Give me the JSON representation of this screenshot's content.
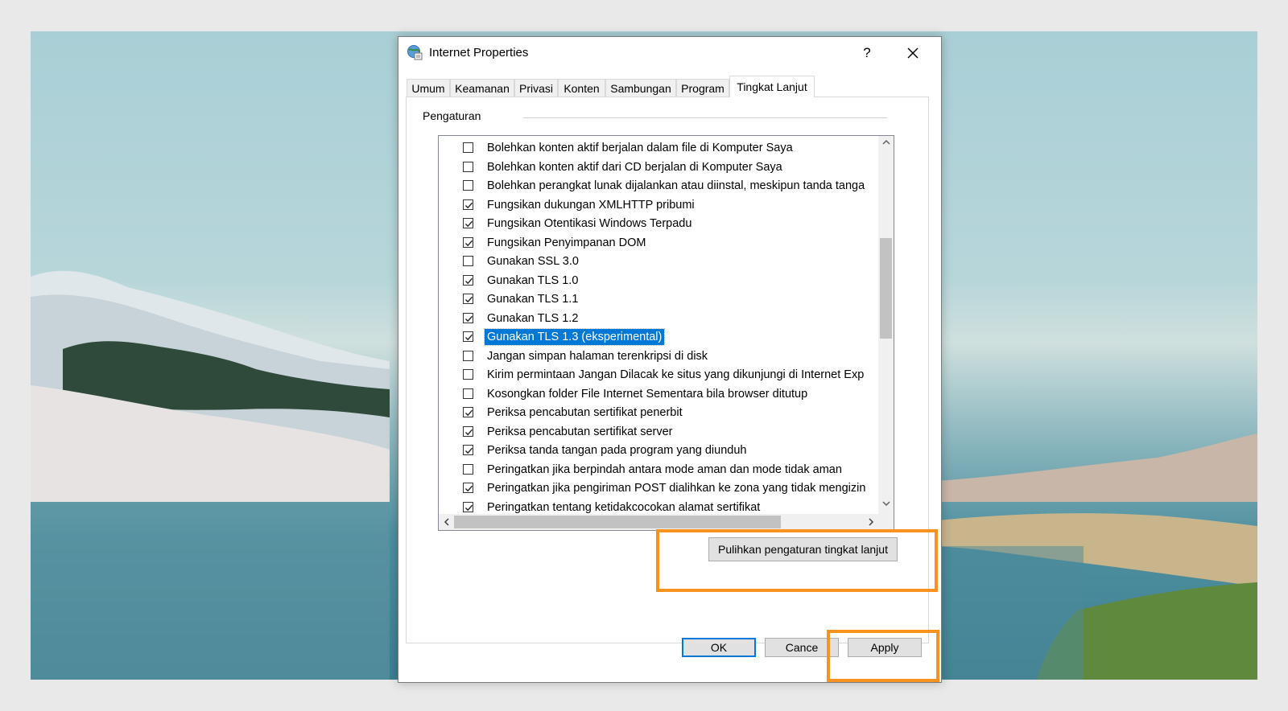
{
  "window": {
    "title": "Internet Properties",
    "help_label": "?",
    "close_label": "✕"
  },
  "tabs": [
    {
      "label": "Umum",
      "active": false
    },
    {
      "label": "Keamanan",
      "active": false
    },
    {
      "label": "Privasi",
      "active": false
    },
    {
      "label": "Konten",
      "active": false
    },
    {
      "label": "Sambungan",
      "active": false
    },
    {
      "label": "Program",
      "active": false
    },
    {
      "label": "Tingkat Lanjut",
      "active": true
    }
  ],
  "settings": {
    "group_label": "Pengaturan",
    "items": [
      {
        "label": "Bolehkan konten aktif berjalan dalam file di Komputer Saya",
        "checked": false,
        "selected": false
      },
      {
        "label": "Bolehkan konten aktif dari CD berjalan di Komputer Saya",
        "checked": false,
        "selected": false
      },
      {
        "label": "Bolehkan perangkat lunak dijalankan atau diinstal, meskipun tanda tanga",
        "checked": false,
        "selected": false
      },
      {
        "label": "Fungsikan dukungan XMLHTTP pribumi",
        "checked": true,
        "selected": false
      },
      {
        "label": "Fungsikan Otentikasi Windows Terpadu",
        "checked": true,
        "selected": false
      },
      {
        "label": "Fungsikan Penyimpanan DOM",
        "checked": true,
        "selected": false
      },
      {
        "label": "Gunakan SSL 3.0",
        "checked": false,
        "selected": false
      },
      {
        "label": "Gunakan TLS 1.0",
        "checked": true,
        "selected": false
      },
      {
        "label": "Gunakan TLS 1.1",
        "checked": true,
        "selected": false
      },
      {
        "label": "Gunakan TLS 1.2",
        "checked": true,
        "selected": false
      },
      {
        "label": "Gunakan TLS 1.3 (eksperimental)",
        "checked": true,
        "selected": true
      },
      {
        "label": "Jangan simpan halaman terenkripsi di disk",
        "checked": false,
        "selected": false
      },
      {
        "label": "Kirim permintaan Jangan Dilacak ke situs yang dikunjungi di Internet Exp",
        "checked": false,
        "selected": false
      },
      {
        "label": "Kosongkan folder File Internet Sementara bila browser ditutup",
        "checked": false,
        "selected": false
      },
      {
        "label": "Periksa pencabutan sertifikat penerbit",
        "checked": true,
        "selected": false
      },
      {
        "label": "Periksa pencabutan sertifikat server",
        "checked": true,
        "selected": false
      },
      {
        "label": "Periksa tanda tangan pada program yang diunduh",
        "checked": true,
        "selected": false
      },
      {
        "label": "Peringatkan jika berpindah antara mode aman dan mode tidak aman",
        "checked": false,
        "selected": false
      },
      {
        "label": "Peringatkan jika pengiriman POST dialihkan ke zona yang tidak mengizin",
        "checked": true,
        "selected": false
      },
      {
        "label": "Peringatkan tentang ketidakcocokan alamat sertifikat",
        "checked": true,
        "selected": false
      }
    ],
    "scroll_up_icon": "chevron-up-icon",
    "scroll_down_icon": "chevron-down-icon",
    "scroll_left_icon": "chevron-left-icon",
    "scroll_right_icon": "chevron-right-icon"
  },
  "restore_button_label": "Pulihkan pengaturan tingkat lanjut",
  "footer": {
    "ok_label": "OK",
    "cancel_label": "Cance",
    "apply_label": "Apply"
  },
  "colors": {
    "selection": "#0078d7",
    "highlight_box": "#f7931e"
  }
}
